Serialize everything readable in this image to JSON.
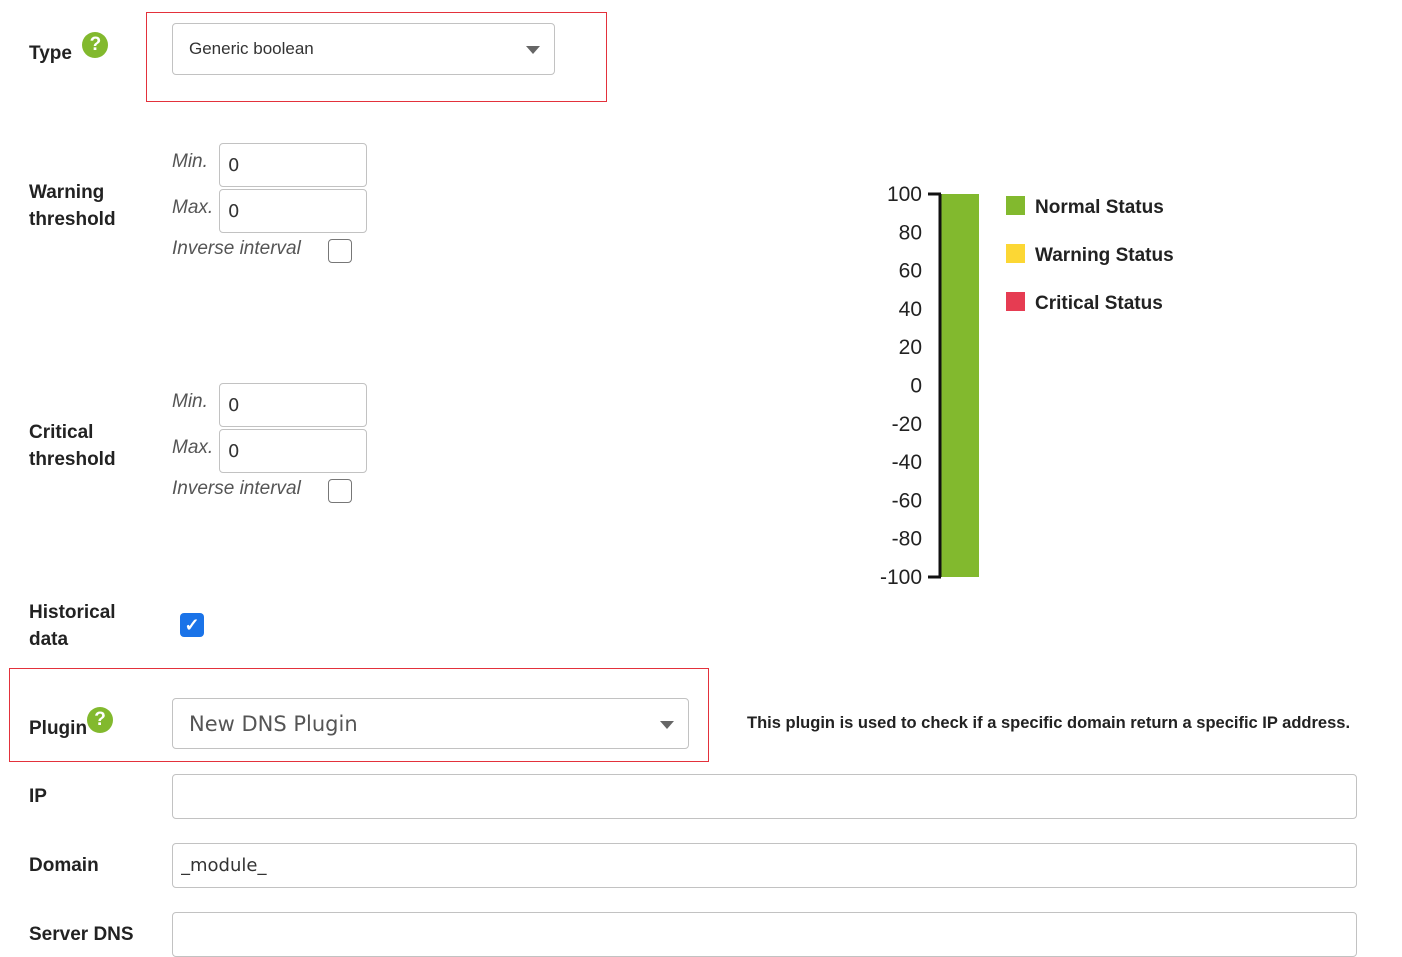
{
  "type": {
    "label": "Type",
    "help_icon": "question-circle",
    "value": "Generic boolean"
  },
  "warning_threshold": {
    "label_line1": "Warning",
    "label_line2": "threshold",
    "min_label": "Min.",
    "min_value": "0",
    "max_label": "Max.",
    "max_value": "0",
    "inverse_label": "Inverse interval",
    "inverse_checked": false
  },
  "critical_threshold": {
    "label_line1": "Critical",
    "label_line2": "threshold",
    "min_label": "Min.",
    "min_value": "0",
    "max_label": "Max.",
    "max_value": "0",
    "inverse_label": "Inverse interval",
    "inverse_checked": false
  },
  "historical_data": {
    "label_line1": "Historical",
    "label_line2": "data",
    "checked": true
  },
  "plugin": {
    "label": "Plugin",
    "help_icon": "question-circle",
    "value": "New DNS Plugin",
    "description": "This plugin is used to check if a specific domain return a specific IP address."
  },
  "fields": {
    "ip": {
      "label": "IP",
      "value": ""
    },
    "domain": {
      "label": "Domain",
      "value": "_module_"
    },
    "server_dns": {
      "label": "Server DNS",
      "value": ""
    }
  },
  "colors": {
    "normal": "#82b92e",
    "warning": "#fcd734",
    "critical": "#e63c52",
    "highlight_border": "#e3313b"
  },
  "chart_data": {
    "type": "bar",
    "ylim": [
      -100,
      100
    ],
    "yticks": [
      "100",
      "80",
      "60",
      "40",
      "20",
      "0",
      "-20",
      "-40",
      "-60",
      "-80",
      "-100"
    ],
    "bands": [
      {
        "status": "normal",
        "from": -100,
        "to": 100
      }
    ],
    "legend": [
      {
        "label": "Normal Status",
        "status": "normal"
      },
      {
        "label": "Warning Status",
        "status": "warning"
      },
      {
        "label": "Critical Status",
        "status": "critical"
      }
    ]
  }
}
